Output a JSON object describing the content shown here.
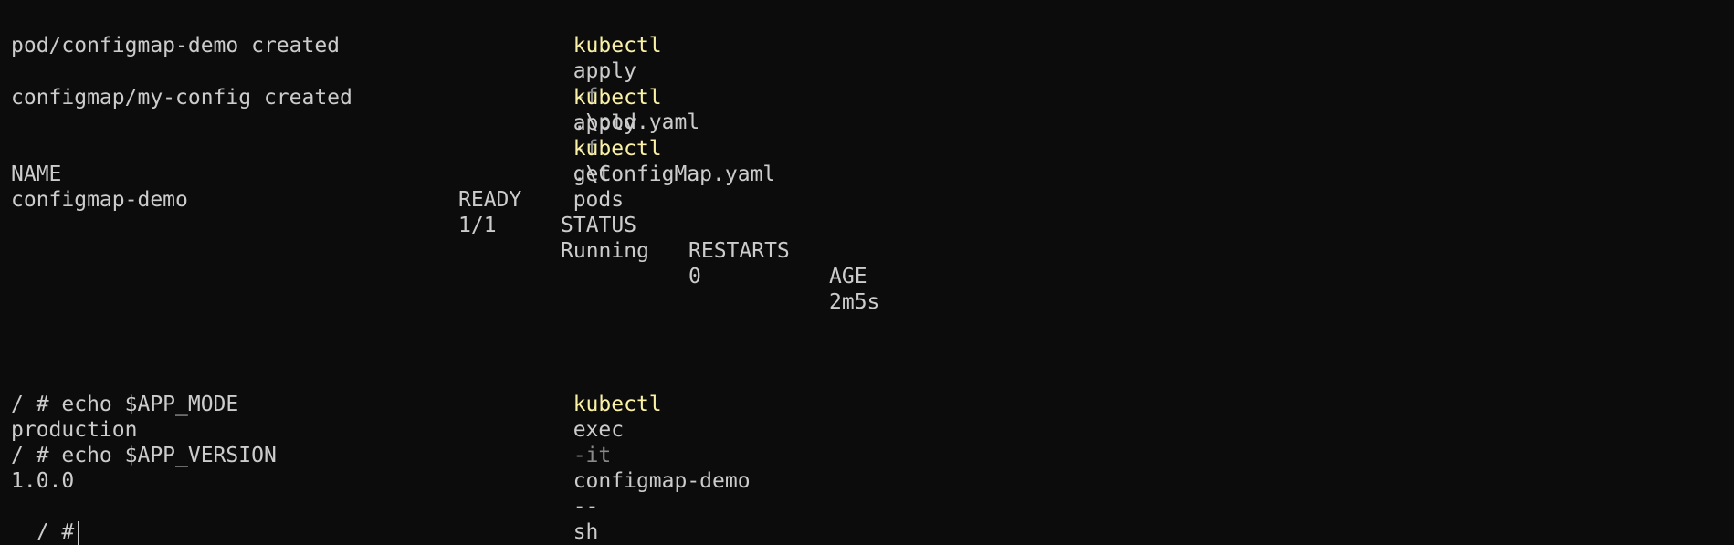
{
  "terminal": {
    "cmd1": {
      "program": "kubectl",
      "verb": "apply",
      "flag": "-f",
      "arg": ".\\pod.yaml"
    },
    "out1": "pod/configmap-demo created",
    "cmd2": {
      "program": "kubectl",
      "verb": "apply",
      "flag": "-f",
      "arg": ".\\ConfigMap.yaml"
    },
    "out2": "configmap/my-config created",
    "cmd3": {
      "program": "kubectl",
      "verb": "get",
      "arg": "pods"
    },
    "table": {
      "headers": [
        "NAME",
        "READY",
        "STATUS",
        "RESTARTS",
        "AGE"
      ],
      "rows": [
        [
          "configmap-demo",
          "1/1",
          "Running",
          "0",
          "2m5s"
        ]
      ]
    },
    "cmd4": {
      "program": "kubectl",
      "verb": "exec",
      "flag": "-it",
      "arg": "configmap-demo",
      "sep": "--",
      "shell": "sh"
    },
    "shell_lines": [
      "/ # echo $APP_MODE",
      "production",
      "/ # echo $APP_VERSION",
      "1.0.0"
    ],
    "prompt": "/ #"
  }
}
